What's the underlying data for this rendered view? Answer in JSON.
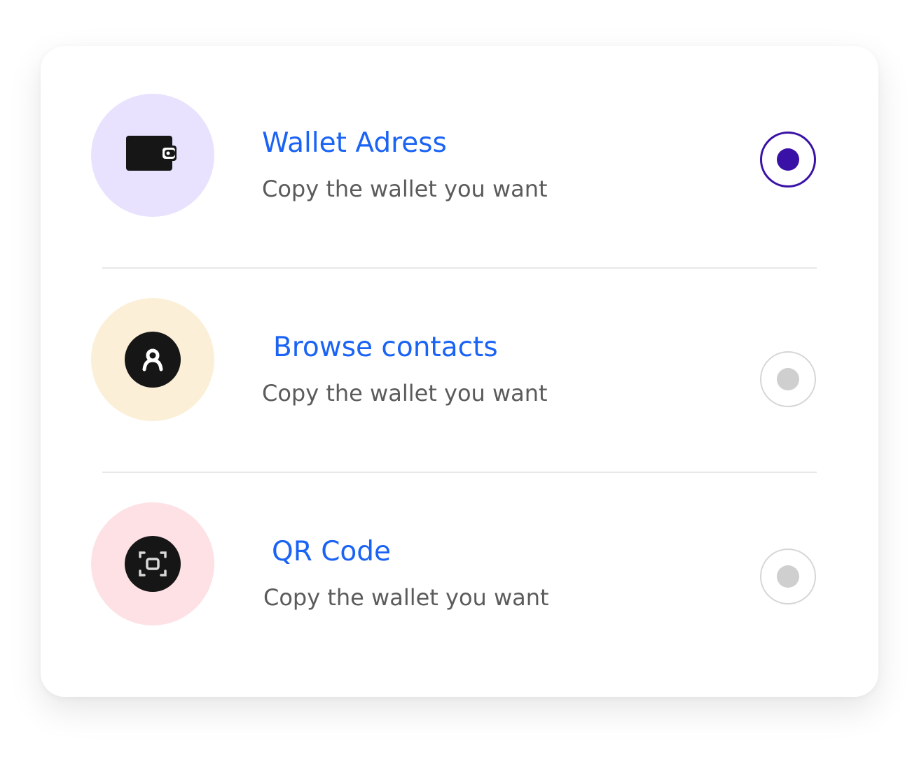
{
  "options": [
    {
      "title": "Wallet Adress",
      "subtitle": "Copy the wallet you want",
      "icon": "wallet-icon",
      "circle_color": "#e8e2ff",
      "selected": true
    },
    {
      "title": "Browse contacts",
      "subtitle": "Copy the wallet you want",
      "icon": "contact-icon",
      "circle_color": "#fcefd8",
      "selected": false
    },
    {
      "title": "QR Code",
      "subtitle": "Copy the wallet you want",
      "icon": "qr-scan-icon",
      "circle_color": "#fde1e4",
      "selected": false
    }
  ],
  "colors": {
    "accent_text": "#1a63f5",
    "selected_radio": "#3a11a6",
    "unselected_radio_dot": "#cfcfcf"
  }
}
